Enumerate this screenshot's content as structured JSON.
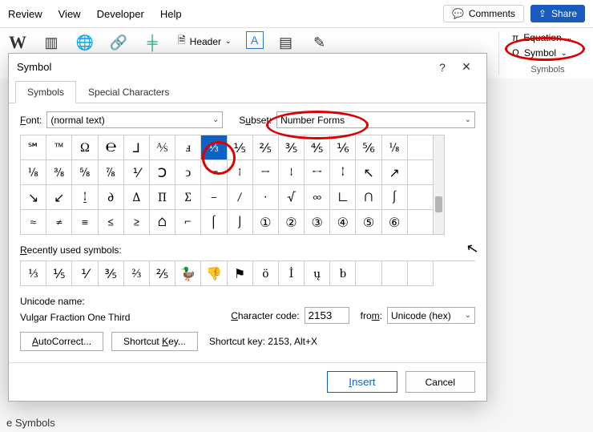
{
  "menu": {
    "items": [
      "Review",
      "View",
      "Developer",
      "Help"
    ]
  },
  "header": {
    "comments": "Comments",
    "share": "Share",
    "header_btn": "Header",
    "equation": "Equation",
    "symbol": "Symbol",
    "symbols_group": "Symbols"
  },
  "dialog": {
    "title": "Symbol",
    "tabs": {
      "symbols": "Symbols",
      "special": "Special Characters"
    },
    "font_label": "Font:",
    "font_value": "(normal text)",
    "subset_label": "Subset:",
    "subset_value": "Number Forms",
    "recent_label": "Recently used symbols:",
    "unicode_label": "Unicode name:",
    "unicode_name": "Vulgar Fraction One Third",
    "char_label": "Character code:",
    "char_value": "2153",
    "from_label": "from:",
    "from_value": "Unicode (hex)",
    "autocorrect": "AutoCorrect...",
    "shortcut_btn": "Shortcut Key...",
    "shortcut_text": "Shortcut key: 2153, Alt+X",
    "insert": "Insert",
    "cancel": "Cancel"
  },
  "grid": [
    [
      "℠",
      "™",
      "Ω",
      "℮",
      "⅃",
      "⅍",
      "ⅎ",
      "⅓",
      "⅕",
      "⅖",
      "⅗",
      "⅘",
      "⅙",
      "⅚",
      "⅛"
    ],
    [
      "⅛",
      "⅜",
      "⅝",
      "⅞",
      "⅟",
      "Ↄ",
      "ↄ",
      "←",
      "↑",
      "→",
      "↓",
      "↔",
      "↕",
      "↖",
      "↗"
    ],
    [
      "↘",
      "↙",
      "↨",
      "∂",
      "∆",
      "∏",
      "∑",
      "−",
      "∕",
      "∙",
      "√",
      "∞",
      "∟",
      "∩",
      "∫"
    ],
    [
      "≈",
      "≠",
      "≡",
      "≤",
      "≥",
      "⌂",
      "⌐",
      "⌠",
      "⌡",
      "①",
      "②",
      "③",
      "④",
      "⑤",
      "⑥"
    ]
  ],
  "grid_selected": "⅓",
  "recent": [
    "⅓",
    "⅕",
    "⅟",
    "⅗",
    "⅔",
    "⅖",
    "🦆",
    "👎",
    "⚑",
    "ö",
    "İ",
    "ų",
    "b",
    "",
    "",
    ""
  ],
  "bottom_note": "e Symbols"
}
